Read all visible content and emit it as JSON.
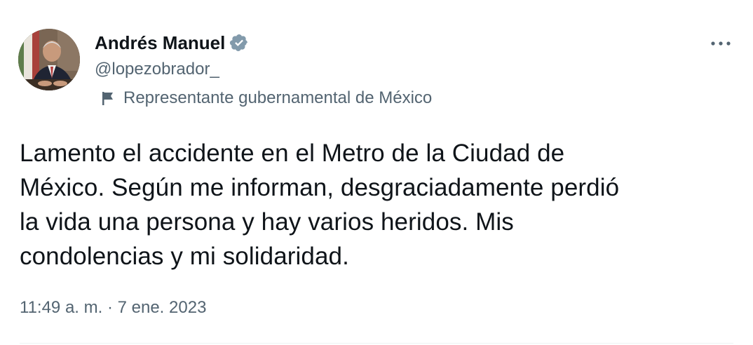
{
  "author": {
    "display_name": "Andrés Manuel",
    "handle": "@lopezobrador_",
    "verified_icon": "verified-badge-icon",
    "verified_color": "#1d9bf0"
  },
  "label": {
    "icon": "flag-icon",
    "text": "Representante gubernamental de México"
  },
  "more_icon": "more-horizontal-icon",
  "tweet": {
    "lines": [
      "Lamento el accidente en el Metro de la Ciudad de",
      "México. Según me informan, desgraciadamente perdió",
      "la vida una persona y hay varios heridos. Mis",
      "condolencias y mi solidaridad."
    ]
  },
  "meta": {
    "time": "11:49 a. m.",
    "separator": " · ",
    "date": "7 ene. 2023"
  },
  "colors": {
    "text_primary": "#0f1419",
    "text_secondary": "#536471",
    "divider": "#eff3f4"
  }
}
